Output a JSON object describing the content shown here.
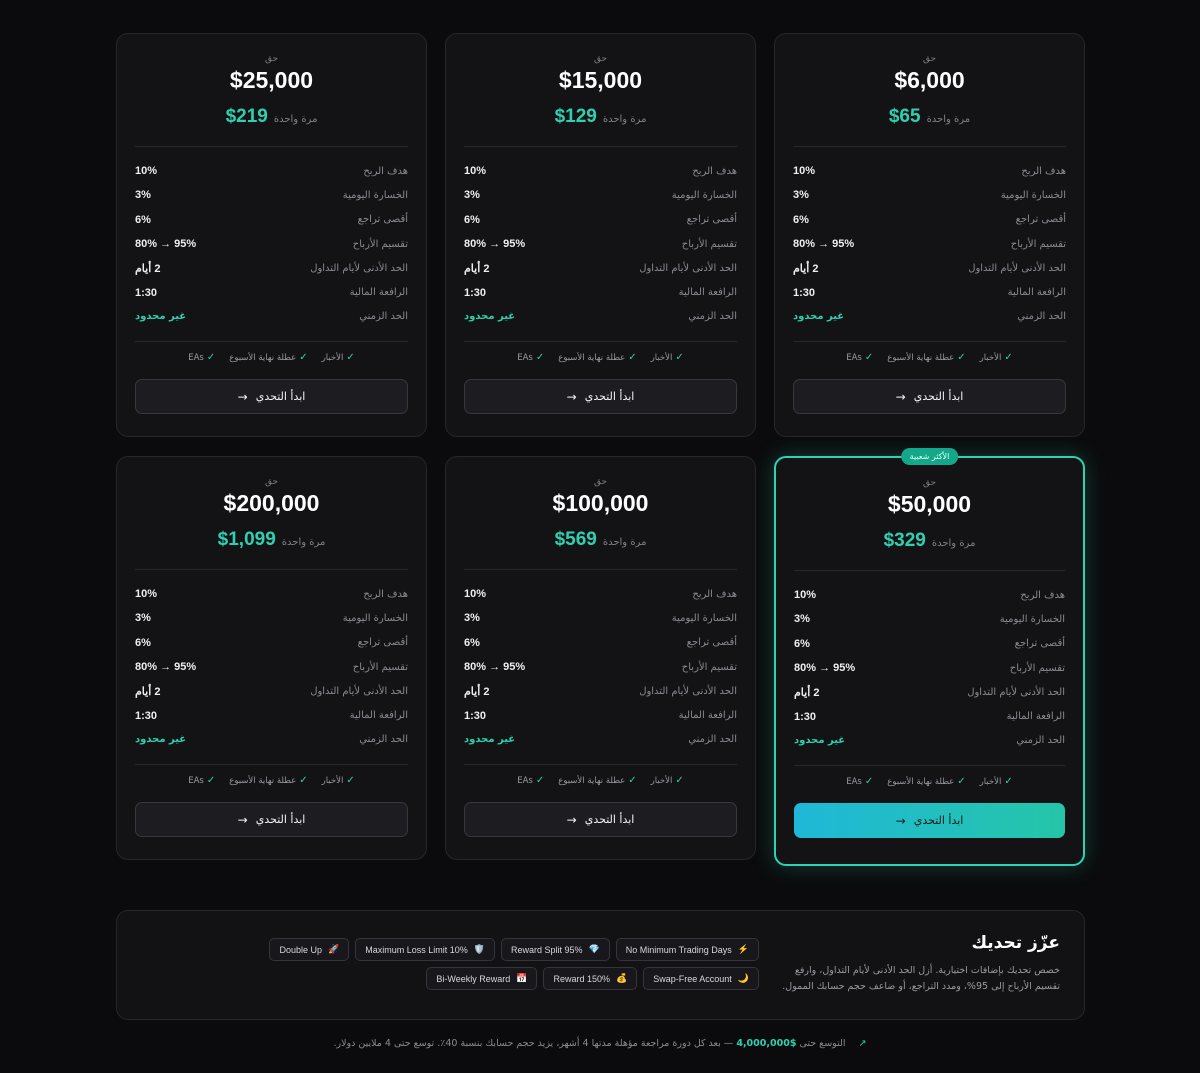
{
  "colors": {
    "accent": "#2fd0b0",
    "background": "#0b0b0d",
    "card": "#131316"
  },
  "plans": [
    {
      "cap": "حق",
      "size": "$25,000",
      "price": "$219",
      "once": "مرة واحدة",
      "featured": false
    },
    {
      "cap": "حق",
      "size": "$15,000",
      "price": "$129",
      "once": "مرة واحدة",
      "featured": false
    },
    {
      "cap": "حق",
      "size": "$6,000",
      "price": "$65",
      "once": "مرة واحدة",
      "featured": false
    },
    {
      "cap": "حق",
      "size": "$200,000",
      "price": "$1,099",
      "once": "مرة واحدة",
      "featured": false
    },
    {
      "cap": "حق",
      "size": "$100,000",
      "price": "$569",
      "once": "مرة واحدة",
      "featured": false
    },
    {
      "cap": "حق",
      "size": "$50,000",
      "price": "$329",
      "once": "مرة واحدة",
      "featured": true,
      "badge": "الأكثر شعبية"
    }
  ],
  "rules": [
    {
      "label": "هدف الربح",
      "value": "10%"
    },
    {
      "label": "الخسارة اليومية",
      "value": "3%"
    },
    {
      "label": "أقصى تراجع",
      "value": "6%"
    },
    {
      "label": "تقسيم الأرباح",
      "value": "95% → 80%"
    },
    {
      "label": "الحد الأدنى لأيام التداول",
      "value": "2 أيام"
    },
    {
      "label": "الرافعة المالية",
      "value": "1:30"
    },
    {
      "label": "الحد الزمني",
      "value": "غير محدود",
      "accent": true
    }
  ],
  "features": [
    {
      "label": "الأخبار",
      "icon": "check-icon"
    },
    {
      "label": "عطلة نهاية الأسبوع",
      "icon": "check-icon"
    },
    {
      "label": "EAs",
      "icon": "check-icon"
    }
  ],
  "cta": {
    "label": "ابدأ التحدي",
    "icon": "arrow-right-icon"
  },
  "boost": {
    "title": "عزّز تحديك",
    "description": "خصص تحديك بإضافات اختيارية. أزل الحد الأدنى لأيام التداول، وارفع تقسيم الأرباح إلى 95%، ومدد التراجع، أو ضاعف حجم حسابك الممول.",
    "chips": [
      {
        "label": "Double Up",
        "icon": "🚀"
      },
      {
        "label": "Maximum Loss Limit 10%",
        "icon": "🛡️"
      },
      {
        "label": "Reward Split 95%",
        "icon": "💎"
      },
      {
        "label": "No Minimum Trading Days",
        "icon": "⚡"
      },
      {
        "label": "Bi-Weekly Reward",
        "icon": "📅"
      },
      {
        "label": "Reward 150%",
        "icon": "💰"
      },
      {
        "label": "Swap-Free Account",
        "icon": "🌙"
      }
    ]
  },
  "footer": {
    "prefix": "التوسع حتى",
    "amount": "$4,000,000",
    "suffix": "— بعد كل دورة مراجعة مؤهلة مدتها 4 أشهر، يزيد حجم حسابك بنسبة 40٪. توسع حتى 4 ملايين دولار.",
    "icon": "trending-up-icon"
  }
}
